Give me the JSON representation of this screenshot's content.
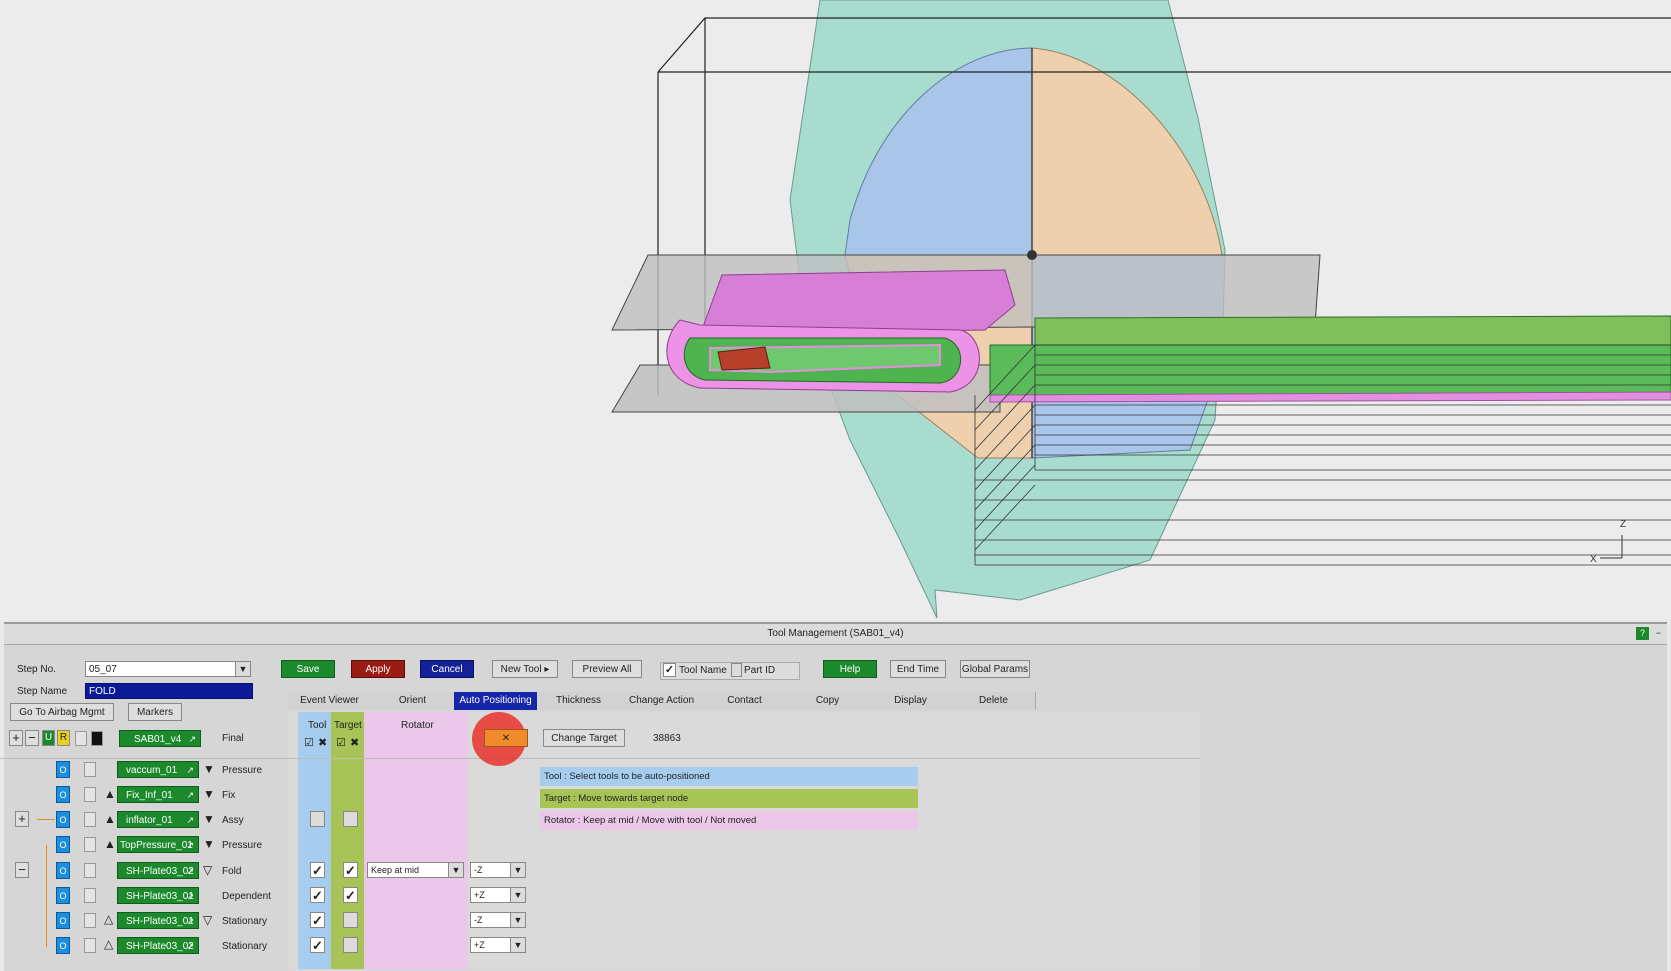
{
  "window": {
    "title": "Tool Management (SAB01_v4)",
    "help_glyph": "?",
    "min_glyph": "−"
  },
  "step": {
    "no_label": "Step No.",
    "no_value": "05_07",
    "name_label": "Step Name",
    "name_value": "FOLD"
  },
  "nav": {
    "airbag_mgmt": "Go To Airbag Mgmt",
    "markers": "Markers"
  },
  "toolbar": {
    "save": "Save",
    "apply": "Apply",
    "cancel": "Cancel",
    "new_tool": "New Tool",
    "preview_all": "Preview All",
    "tool_name": "Tool Name",
    "tool_name_checked": true,
    "part_id": "Part ID",
    "part_id_checked": false,
    "help": "Help",
    "end_time": "End Time",
    "global_params": "Global Params"
  },
  "tabs": [
    "Event Viewer",
    "Orient",
    "Auto Positioning",
    "Thickness",
    "Change Action",
    "Contact",
    "Copy",
    "Display",
    "Delete"
  ],
  "active_tab": "Auto Positioning",
  "header_row": {
    "expand": "+",
    "collapse": "−",
    "u": "U",
    "r": "R",
    "model": "SAB01_v4",
    "action": "Final",
    "tool_col": "Tool",
    "target_col": "Target",
    "rotator_col": "Rotator",
    "change_target": "Change Target",
    "target_node": "38863"
  },
  "legend": {
    "tool": "Tool    : Select tools to be auto-positioned",
    "target": "Target  : Move towards target node",
    "rotator": "Rotator : Keep at mid / Move with tool / Not moved",
    "tool_color": "#a6cdee",
    "target_color": "#a8c456",
    "rotator_color": "#ebc8ea"
  },
  "rows": [
    {
      "name": "vaccum_01",
      "action": "Pressure",
      "o": "O"
    },
    {
      "name": "Fix_Inf_01",
      "action": "Fix",
      "o": "O"
    },
    {
      "name": "inflator_01",
      "action": "Assy",
      "o": "O"
    },
    {
      "name": "TopPressure_01",
      "action": "Pressure",
      "o": "O"
    },
    {
      "name": "SH-Plate03_02",
      "action": "Fold",
      "o": "O",
      "rotator": "Keep at mid",
      "dir": "-Z"
    },
    {
      "name": "SH-Plate03_01",
      "action": "Dependent",
      "o": "O",
      "dir": "+Z"
    },
    {
      "name": "SH-Plate03_01",
      "action": "Stationary",
      "o": "O",
      "dir": "-Z"
    },
    {
      "name": "SH-Plate03_02",
      "action": "Stationary",
      "o": "O",
      "dir": "+Z"
    }
  ],
  "axes": {
    "z": "Z",
    "x": "X"
  },
  "colors": {
    "accent_green": "#1c8a2c",
    "apply_red": "#9a1a14",
    "cancel_blue": "#14229a",
    "active_tab": "#1526a8",
    "cursor_highlight": "#e8332a"
  }
}
